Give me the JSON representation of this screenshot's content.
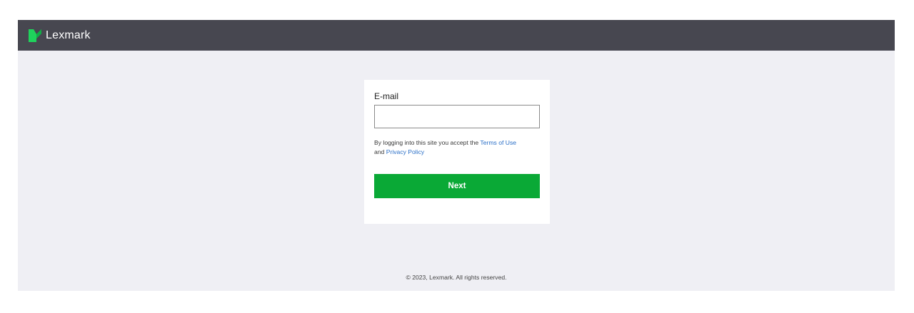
{
  "header": {
    "brand": "Lexmark",
    "logo_icon": "lexmark-logo-icon",
    "bar_color": "#474750",
    "logo_color": "#17c653"
  },
  "login": {
    "email_label": "E-mail",
    "email_value": "",
    "email_placeholder": "",
    "terms_prefix": "By logging into this site you accept the",
    "terms_link": "Terms of Use",
    "terms_and": "and",
    "privacy_link": "Privacy Policy",
    "next_label": "Next",
    "button_color": "#0aa936",
    "link_color": "#2a6fc7"
  },
  "footer": {
    "copyright": "© 2023, Lexmark. All rights reserved."
  }
}
